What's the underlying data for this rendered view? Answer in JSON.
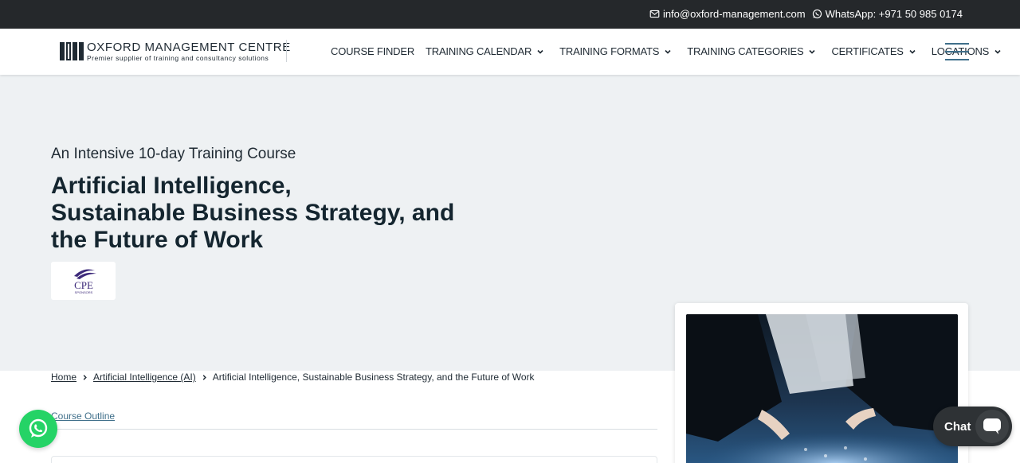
{
  "topbar": {
    "email": "info@oxford-management.com",
    "whatsapp": "WhatsApp: +971 50 985 0174"
  },
  "header": {
    "logo_title": "OXFORD MANAGEMENT CENTRE",
    "logo_tagline": "Premier supplier of training and consultancy solutions",
    "nav": [
      {
        "label": "COURSE FINDER",
        "has_dropdown": false
      },
      {
        "label": "TRAINING CALENDAR",
        "has_dropdown": true
      },
      {
        "label": "TRAINING FORMATS",
        "has_dropdown": true
      },
      {
        "label": "TRAINING CATEGORIES",
        "has_dropdown": true
      },
      {
        "label": "CERTIFICATES",
        "has_dropdown": true
      },
      {
        "label": "LOCATIONS",
        "has_dropdown": true
      }
    ]
  },
  "hero": {
    "kicker": "An Intensive 10-day Training Course",
    "title_line1": "Artificial Intelligence,",
    "title_line2": "Sustainable Business Strategy, and",
    "title_line3": "the Future of Work",
    "badge_text": "CPE",
    "badge_subtext": "SPONSORS"
  },
  "breadcrumb": {
    "items": [
      "Home",
      "Artificial Intelligence (AI)",
      "Artificial Intelligence, Sustainable Business Strategy, and the Future of Work"
    ]
  },
  "tabs": {
    "course_outline": "Course Outline"
  },
  "chat": {
    "label": "Chat"
  },
  "colors": {
    "topbar_bg": "#25282b",
    "hero_bg": "#eef1f3",
    "accent": "#3f6f8a",
    "whatsapp": "#25d366"
  }
}
